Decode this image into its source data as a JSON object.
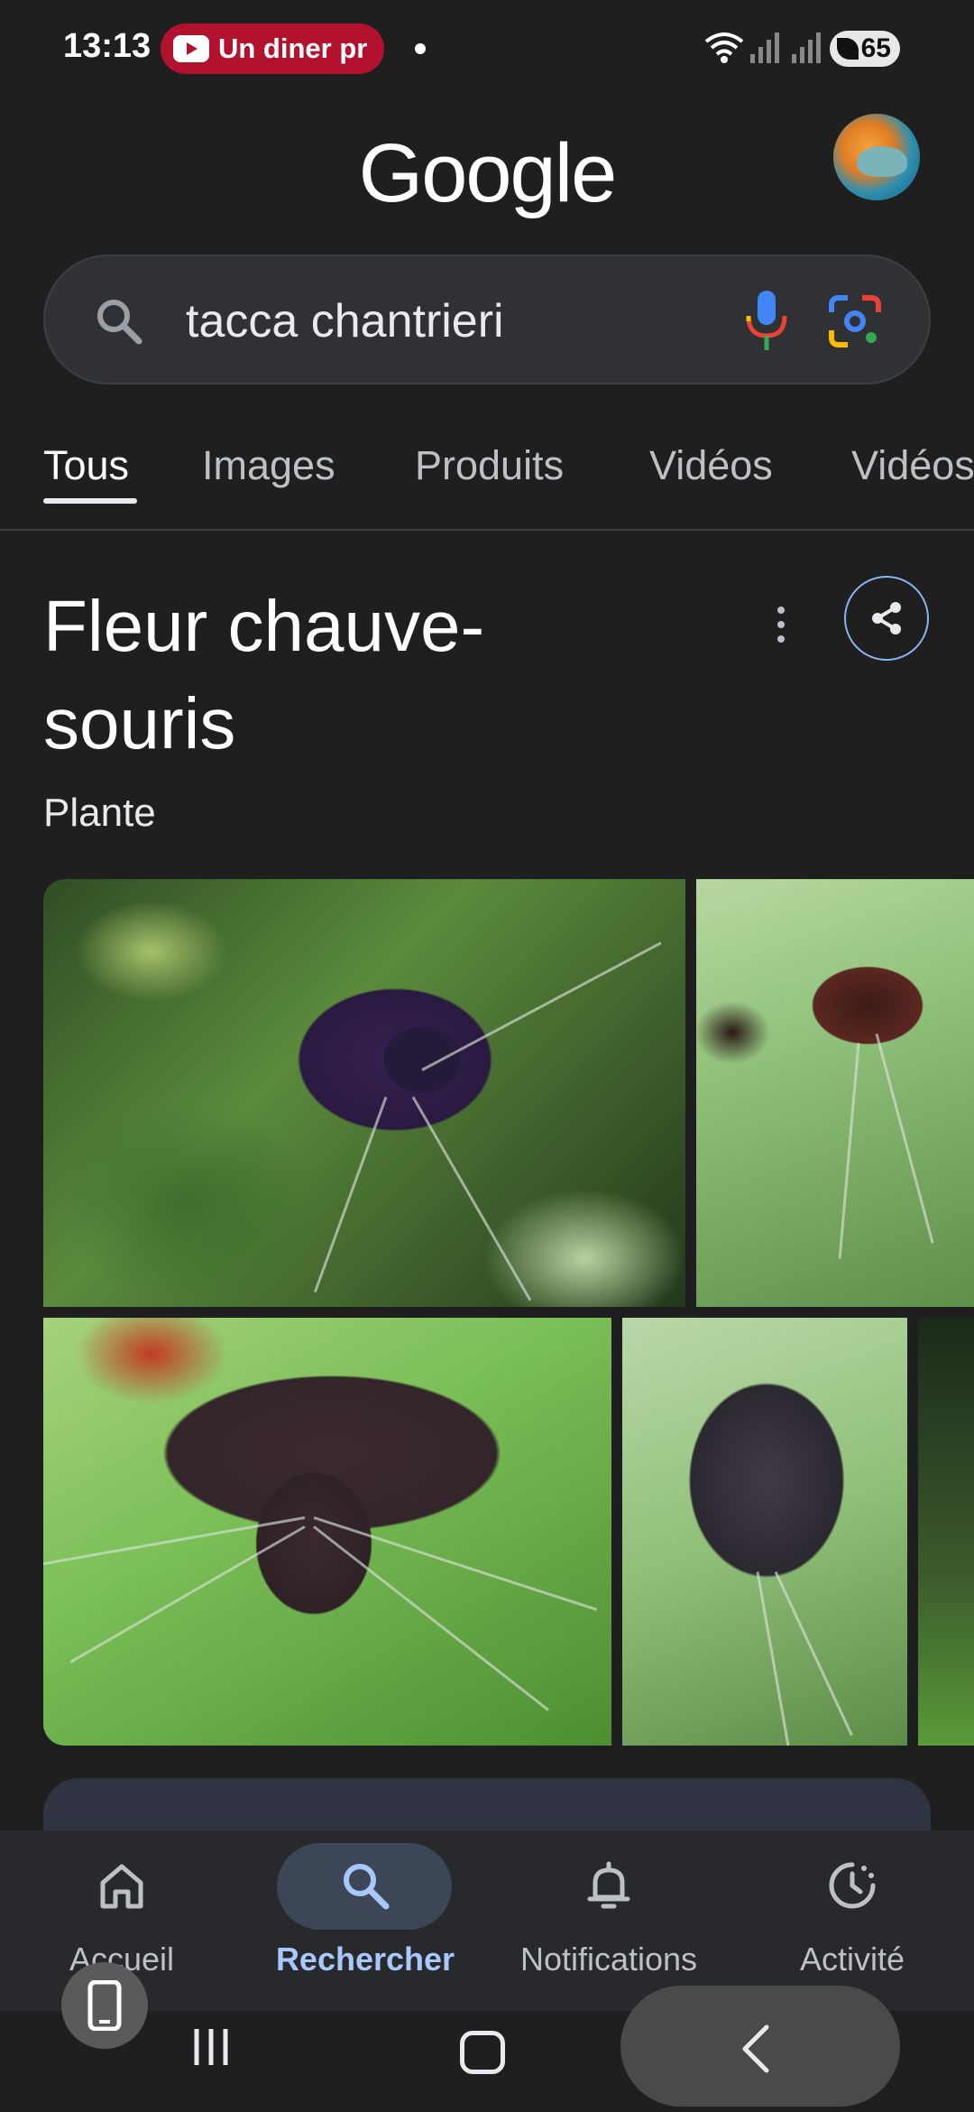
{
  "status_bar": {
    "time": "13:13",
    "media_notification": "Un diner pr",
    "battery": "65"
  },
  "header": {
    "logo_text": "Google"
  },
  "search": {
    "query": "tacca chantrieri"
  },
  "tabs": [
    {
      "label": "Tous",
      "active": true
    },
    {
      "label": "Images",
      "active": false
    },
    {
      "label": "Produits",
      "active": false
    },
    {
      "label": "Vidéos",
      "active": false
    },
    {
      "label": "Vidéos",
      "active": false
    }
  ],
  "knowledge_panel": {
    "title_line1": "Fleur chauve-",
    "title_line2": "souris",
    "subtitle": "Plante"
  },
  "bottom_nav": {
    "items": [
      {
        "label": "Accueil",
        "icon": "home-icon",
        "active": false
      },
      {
        "label": "Rechercher",
        "icon": "search-icon",
        "active": true
      },
      {
        "label": "Notifications",
        "icon": "bell-icon",
        "active": false
      },
      {
        "label": "Activité",
        "icon": "activity-icon",
        "active": false
      }
    ]
  },
  "colors": {
    "background": "#1f1f1f",
    "search_bar": "#303134",
    "accent_blue": "#a8c7fa",
    "youtube_red": "#b3122e"
  }
}
